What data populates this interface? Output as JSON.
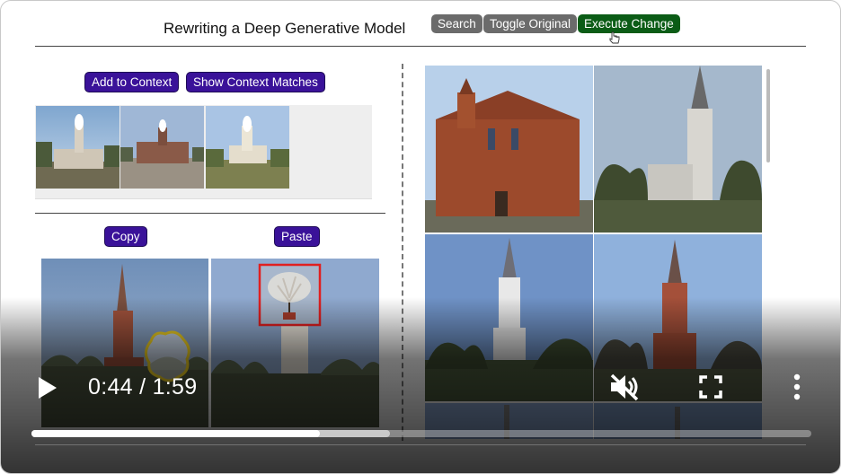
{
  "header": {
    "title": "Rewriting a Deep Generative Model",
    "search_label": "Search",
    "toggle_label": "Toggle Original",
    "execute_label": "Execute Change"
  },
  "context": {
    "add_label": "Add to Context",
    "show_label": "Show Context Matches"
  },
  "edit": {
    "copy_label": "Copy",
    "paste_label": "Paste"
  },
  "video": {
    "time": "0:44 / 1:59",
    "progress": 0.37,
    "buffered": 0.46
  },
  "colors": {
    "gray_button": "#6b6b6b",
    "green_button": "#0b5c16",
    "purple_button": "#3a1299",
    "selection_box": "#e02020",
    "sketch_outline": "#f0d020"
  },
  "icons": [
    "play-icon",
    "mute-icon",
    "fullscreen-icon",
    "more-vert-icon",
    "cursor-icon"
  ]
}
